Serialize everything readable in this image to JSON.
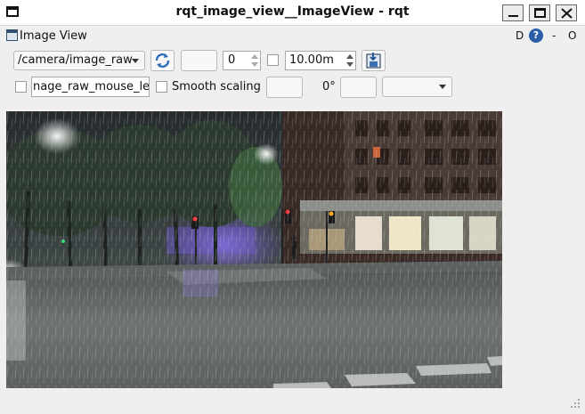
{
  "window": {
    "title": "rqt_image_view__ImageView - rqt"
  },
  "dock": {
    "title": "Image View",
    "d_label": "D",
    "help_label": "?",
    "dash_label": "-",
    "o_label": "O"
  },
  "toolbar": {
    "topic": "/camera/image_raw",
    "spin_value": "0",
    "rate_value": "10.00m",
    "mouse_topic": "nage_raw_mouse_left",
    "smooth_label": "Smooth scaling",
    "rotation": "0°"
  },
  "image": {
    "description_icon": "camera-image"
  },
  "colors": {
    "help_blue": "#2a5ea8",
    "window_bg": "#efefef"
  }
}
